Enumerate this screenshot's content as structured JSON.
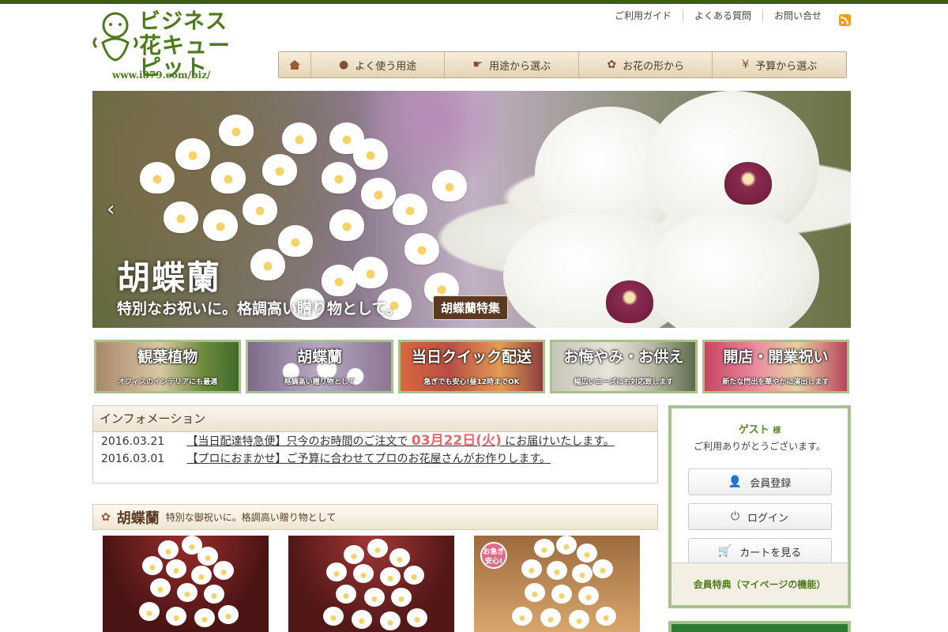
{
  "logo": {
    "line1": "ビジネス",
    "line2": "花キューピット",
    "url": "www.i879.com/biz/"
  },
  "toplinks": [
    "ご利用ガイド",
    "よくある質問",
    "お問い合せ"
  ],
  "nav": {
    "home_icon": "home-icon",
    "items": [
      {
        "label": "よく使う用途",
        "icon": "speech-bubble-icon"
      },
      {
        "label": "用途から選ぶ",
        "icon": "hand-icon"
      },
      {
        "label": "お花の形から",
        "icon": "flower-icon"
      },
      {
        "label": "予算から選ぶ",
        "icon": "yen-icon"
      }
    ]
  },
  "hero": {
    "title": "胡蝶蘭",
    "subtitle": "特別なお祝いに。格調高い贈り物として。",
    "button": "胡蝶蘭特集",
    "prev": "‹"
  },
  "tiles": [
    {
      "title": "観葉植物",
      "sub": "オフィスのインテリアにも最適"
    },
    {
      "title": "胡蝶蘭",
      "sub": "格調高い贈り物として"
    },
    {
      "title": "当日クイック配送",
      "sub": "急ぎでも安心!昼12時までOK"
    },
    {
      "title": "お悔やみ・お供え",
      "sub": "幅広いニーズにも対応致します"
    },
    {
      "title": "開店・開業祝い",
      "sub": "新たな門出を華やかに演出します"
    }
  ],
  "info": {
    "heading": "インフォメーション",
    "rows": [
      {
        "date": "2016.03.21",
        "pre": "【当日配達特急便】只今のお時間のご注文で ",
        "hl": "03月22日(火)",
        "post": " にお届けいたします。"
      },
      {
        "date": "2016.03.01",
        "pre": "【プロにおまかせ】ご予算に合わせてプロのお花屋さんがお作りします。",
        "hl": "",
        "post": ""
      }
    ]
  },
  "section": {
    "title": "胡蝶蘭",
    "sub": "特別な御祝いに。格調高い贈り物として"
  },
  "products": [
    {
      "badge": ""
    },
    {
      "badge": ""
    },
    {
      "badge": "お急ぎ安心!"
    }
  ],
  "sidebar": {
    "guest": "ゲスト",
    "suffix": "様",
    "message": "ご利用ありがとうございます。",
    "buttons": [
      {
        "label": "会員登録",
        "icon": "user-icon"
      },
      {
        "label": "ログイン",
        "icon": "power-icon"
      },
      {
        "label": "カートを見る",
        "icon": "cart-icon"
      }
    ],
    "footer": "会員特典（マイページの機能）"
  },
  "colors": {
    "brand": "#4d7a1a",
    "topbar": "#3e5b12",
    "nav_text": "#4b3826",
    "sidebar_border": "#a8c28b",
    "highlight": "#e36a6a"
  }
}
